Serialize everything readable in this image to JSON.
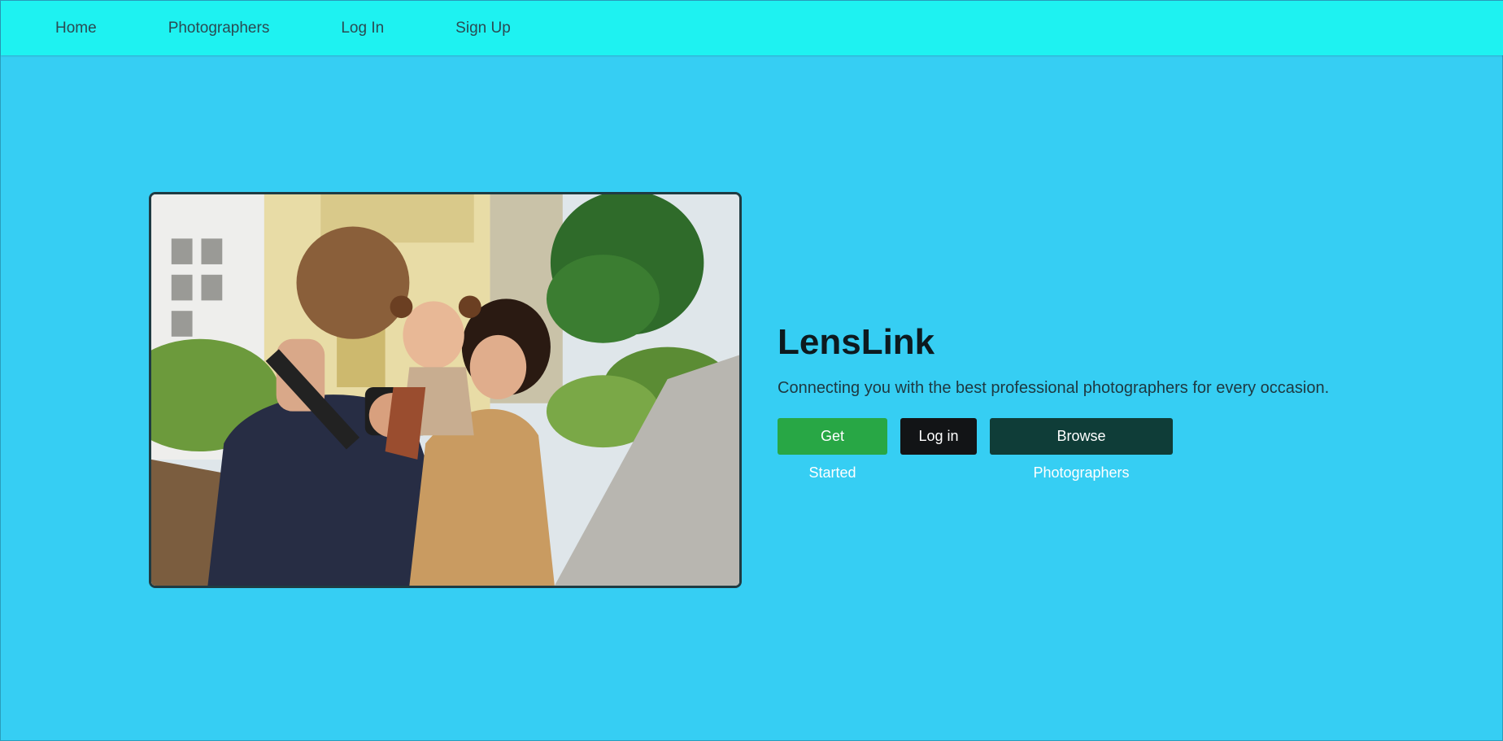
{
  "nav": {
    "items": [
      {
        "label": "Home"
      },
      {
        "label": "Photographers"
      },
      {
        "label": "Log In"
      },
      {
        "label": "Sign Up"
      }
    ]
  },
  "hero": {
    "title": "LensLink",
    "subtitle": "Connecting you with the best professional photographers for every occasion.",
    "buttons": {
      "get_started": "Get Started",
      "log_in": "Log in",
      "browse": "Browse Photographers"
    }
  },
  "colors": {
    "page_bg": "#36cef3",
    "navbar_bg": "#1ef2f1",
    "get_started_bg": "#28a745",
    "log_in_bg": "#121416",
    "browse_bg": "#0f3d38"
  }
}
